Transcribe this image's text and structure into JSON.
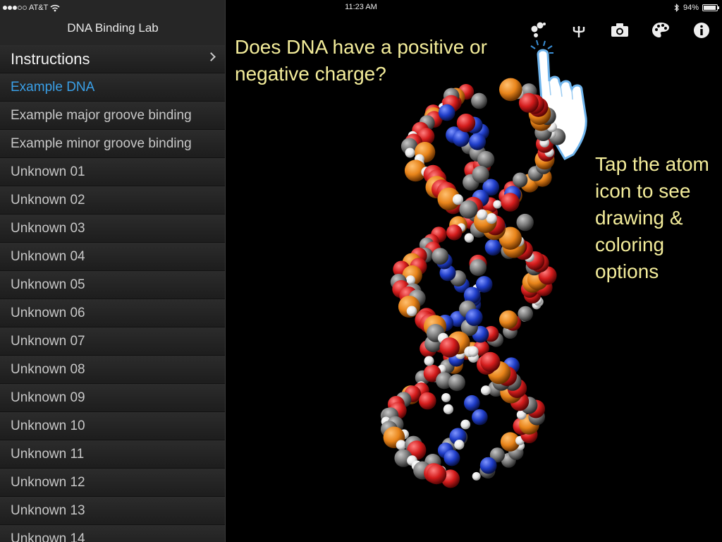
{
  "status": {
    "carrier": "AT&T",
    "time": "11:23 AM",
    "battery_label": "94%",
    "battery_level": 0.94
  },
  "sidebar": {
    "title": "DNA Binding Lab",
    "items": [
      {
        "label": "Instructions"
      },
      {
        "label": "Example DNA"
      },
      {
        "label": "Example major groove binding"
      },
      {
        "label": "Example minor groove binding"
      },
      {
        "label": "Unknown 01"
      },
      {
        "label": "Unknown 02"
      },
      {
        "label": "Unknown 03"
      },
      {
        "label": "Unknown 04"
      },
      {
        "label": "Unknown 05"
      },
      {
        "label": "Unknown 06"
      },
      {
        "label": "Unknown 07"
      },
      {
        "label": "Unknown 08"
      },
      {
        "label": "Unknown 09"
      },
      {
        "label": "Unknown 10"
      },
      {
        "label": "Unknown 11"
      },
      {
        "label": "Unknown 12"
      },
      {
        "label": "Unknown 13"
      },
      {
        "label": "Unknown 14"
      }
    ],
    "selected_index": 1
  },
  "toolbar": {
    "icons": [
      "atom-icon",
      "trident-icon",
      "camera-icon",
      "palette-icon",
      "info-icon"
    ]
  },
  "main": {
    "question": "Does DNA have a positive or negative charge?",
    "hint": "Tap the atom icon to see drawing & coloring options"
  },
  "colors": {
    "accent": "#3aa0e8",
    "annotation": "#f3ec9a",
    "oxygen": "#d42020",
    "phosphorus": "#e8851a",
    "nitrogen": "#2040c8",
    "carbon": "#7a7a7a",
    "hydrogen": "#f0f0f0"
  }
}
